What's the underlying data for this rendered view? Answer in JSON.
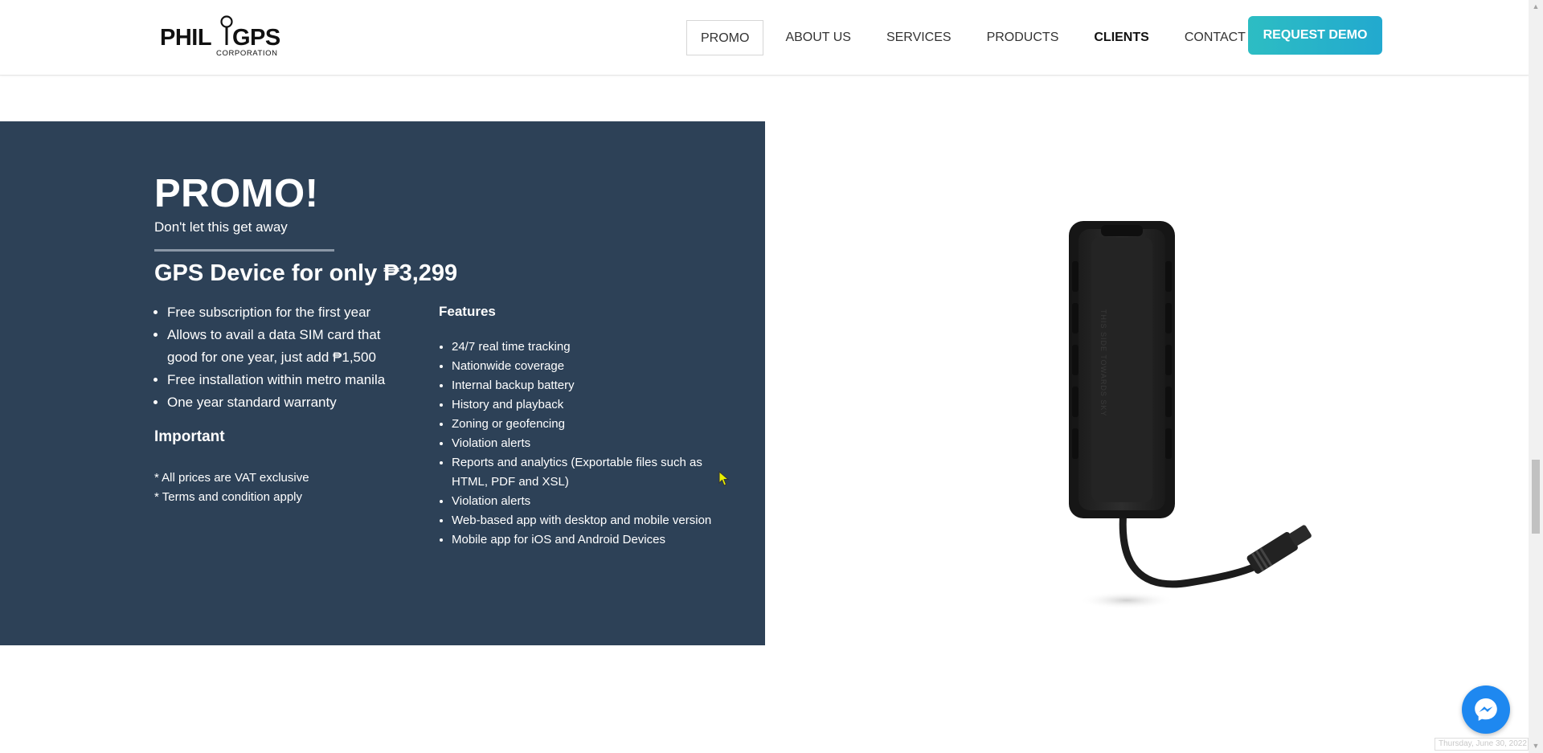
{
  "header": {
    "logo_text": "PHILGPS",
    "logo_sub": "CORPORATION",
    "nav": [
      {
        "label": "PROMO",
        "active": true
      },
      {
        "label": "ABOUT US"
      },
      {
        "label": "SERVICES"
      },
      {
        "label": "PRODUCTS"
      },
      {
        "label": "CLIENTS",
        "bold": true
      },
      {
        "label": "CONTACT US"
      }
    ],
    "cta_label": "REQUEST DEMO",
    "cta_color": "#29b4c9"
  },
  "promo": {
    "title": "PROMO!",
    "subtitle": "Don't let this get away",
    "price_heading": "GPS Device for only ₱3,299",
    "perks": [
      "Free subscription for the first year",
      "Allows to avail a data SIM card that good for one year, just add ₱1,500",
      "Free installation within metro manila",
      "One year standard warranty"
    ],
    "important_heading": "Important",
    "notes": [
      "* All prices are VAT exclusive",
      "* Terms and condition apply"
    ],
    "features_heading": "Features",
    "features": [
      "24/7 real time tracking",
      "Nationwide coverage",
      "Internal backup battery",
      "History and playback",
      "Zoning or geofencing",
      "Violation alerts",
      "Reports and analytics (Exportable files such as HTML, PDF and XSL)",
      "Violation alerts",
      "Web-based app with desktop and mobile version",
      "Mobile app for iOS and Android Devices"
    ],
    "panel_color": "#2d4157"
  },
  "product": {
    "image_label": "GPS tracker device",
    "device_text": "THIS SIDE TOWARDS SKY"
  },
  "widgets": {
    "messenger_icon": "messenger-icon",
    "date_tag": "Thursday, June 30, 2022"
  }
}
